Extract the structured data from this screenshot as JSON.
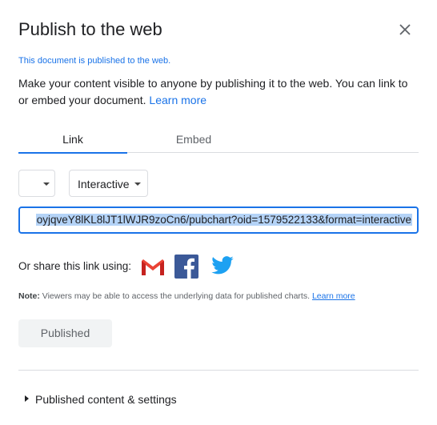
{
  "dialog": {
    "title": "Publish to the web",
    "status": "This document is published to the web.",
    "description": "Make your content visible to anyone by publishing it to the web. You can link to or embed your document. ",
    "learn_more": "Learn more"
  },
  "tabs": [
    {
      "label": "Link",
      "active": true
    },
    {
      "label": "Embed",
      "active": false
    }
  ],
  "selects": {
    "first_value": "",
    "second_value": "Interactive"
  },
  "url": {
    "value": "oyjqveY8lKL8lJT1lWJR9zoCn6/pubchart?oid=1579522133&format=interactive"
  },
  "share": {
    "label": "Or share this link using:",
    "icons": [
      "gmail-icon",
      "facebook-icon",
      "twitter-icon"
    ]
  },
  "note": {
    "prefix": "Note:",
    "text": " Viewers may be able to access the underlying data for published charts. ",
    "learn_more": "Learn more"
  },
  "publish_button": {
    "label": "Published"
  },
  "settings": {
    "label": "Published content & settings"
  },
  "colors": {
    "accent": "#1a73e8",
    "selection": "#b4d3f7"
  }
}
